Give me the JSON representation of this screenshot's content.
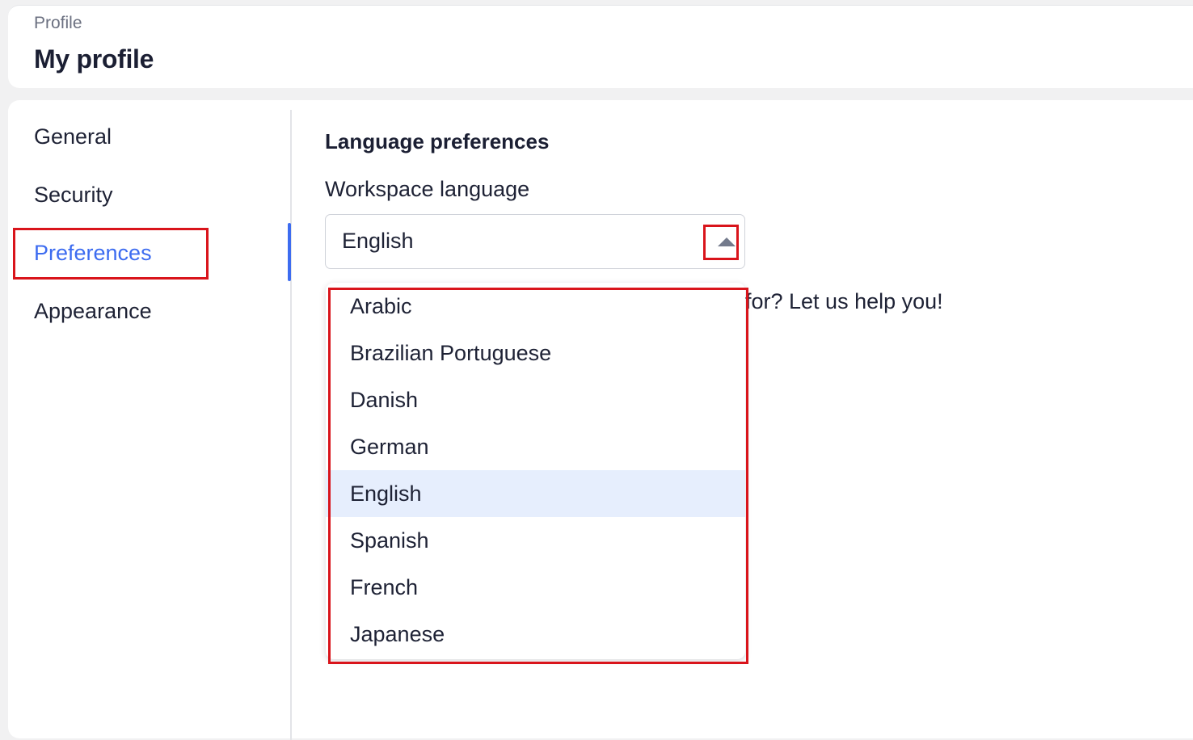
{
  "header": {
    "breadcrumb": "Profile",
    "title": "My profile"
  },
  "sidebar": {
    "items": [
      {
        "label": "General"
      },
      {
        "label": "Security"
      },
      {
        "label": "Preferences",
        "active": true
      },
      {
        "label": "Appearance"
      }
    ]
  },
  "content": {
    "section_title": "Language preferences",
    "field_label": "Workspace language",
    "selected_value": "English",
    "help_text": "for? Let us help you!"
  },
  "dropdown": {
    "options": [
      {
        "label": "Arabic"
      },
      {
        "label": "Brazilian Portuguese"
      },
      {
        "label": "Danish"
      },
      {
        "label": "German"
      },
      {
        "label": "English",
        "selected": true
      },
      {
        "label": "Spanish"
      },
      {
        "label": "French"
      },
      {
        "label": "Japanese"
      }
    ]
  },
  "colors": {
    "accent": "#3d6cf0",
    "highlight": "#d9141b",
    "selected_bg": "#e6eefd"
  },
  "icons": {
    "select_caret": "caret-up-icon"
  }
}
